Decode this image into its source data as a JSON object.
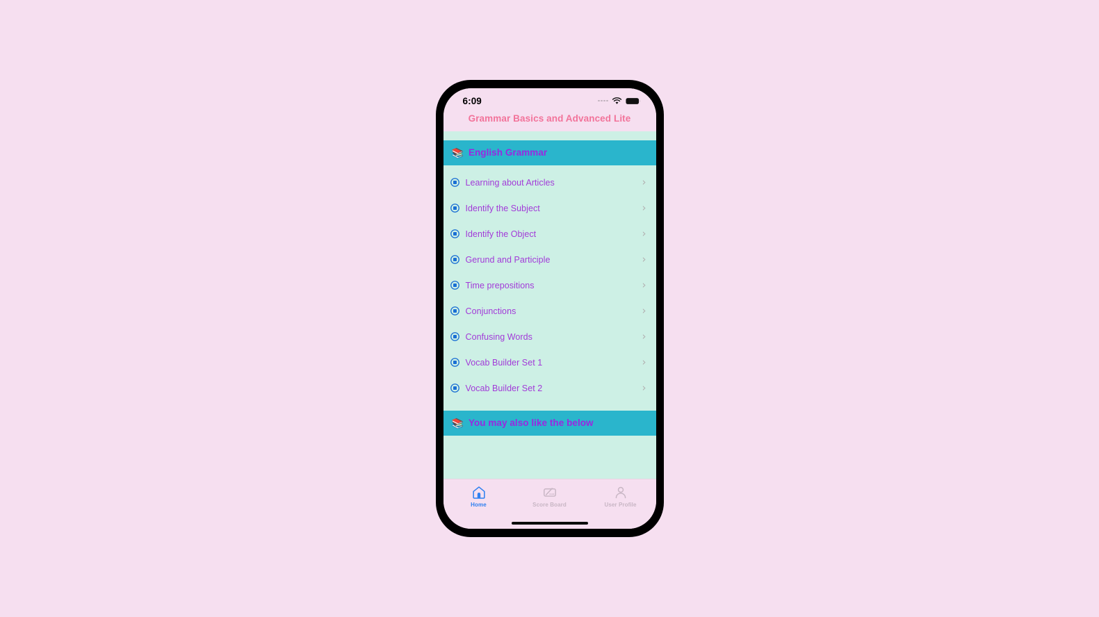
{
  "device": {
    "status_bar": {
      "time": "6:09",
      "signal_icon": "signal-dots-icon",
      "wifi_icon": "wifi-icon",
      "battery_icon": "battery-icon"
    },
    "home_indicator": "home-indicator"
  },
  "app": {
    "title": "Grammar Basics and Advanced Lite",
    "title_color": "#f2739a"
  },
  "theme": {
    "page_background": "#f6dff0",
    "list_background": "#cdf0e5",
    "section_header_background": "#2ab5cc",
    "section_title_color": "#9a28e0",
    "row_label_color": "#a23ad8",
    "chevron_color": "#b2b2b2",
    "tab_active_color": "#2f80f0",
    "tab_inactive_color": "#c8b6c4"
  },
  "sections": [
    {
      "emoji": "📚",
      "emoji_name": "books-emoji",
      "title": "English Grammar",
      "rows": [
        {
          "label": "Learning about Articles",
          "bullet_icon": "circle-square-icon",
          "chevron": "›"
        },
        {
          "label": "Identify the Subject",
          "bullet_icon": "circle-square-icon",
          "chevron": "›"
        },
        {
          "label": "Identify the Object",
          "bullet_icon": "circle-square-icon",
          "chevron": "›"
        },
        {
          "label": "Gerund and Participle",
          "bullet_icon": "circle-square-icon",
          "chevron": "›"
        },
        {
          "label": "Time prepositions",
          "bullet_icon": "circle-square-icon",
          "chevron": "›"
        },
        {
          "label": "Conjunctions",
          "bullet_icon": "circle-square-icon",
          "chevron": "›"
        },
        {
          "label": "Confusing Words",
          "bullet_icon": "circle-square-icon",
          "chevron": "›"
        },
        {
          "label": "Vocab Builder Set 1",
          "bullet_icon": "circle-square-icon",
          "chevron": "›"
        },
        {
          "label": "Vocab Builder Set 2",
          "bullet_icon": "circle-square-icon",
          "chevron": "›"
        }
      ]
    },
    {
      "emoji": "📚",
      "emoji_name": "books-emoji",
      "title": "You may also like the below",
      "rows": []
    }
  ],
  "tab_bar": {
    "items": [
      {
        "label": "Home",
        "icon": "home-icon",
        "active": true
      },
      {
        "label": "Score Board",
        "icon": "score-board-icon",
        "active": false
      },
      {
        "label": "User Profile",
        "icon": "user-profile-icon",
        "active": false
      }
    ]
  }
}
